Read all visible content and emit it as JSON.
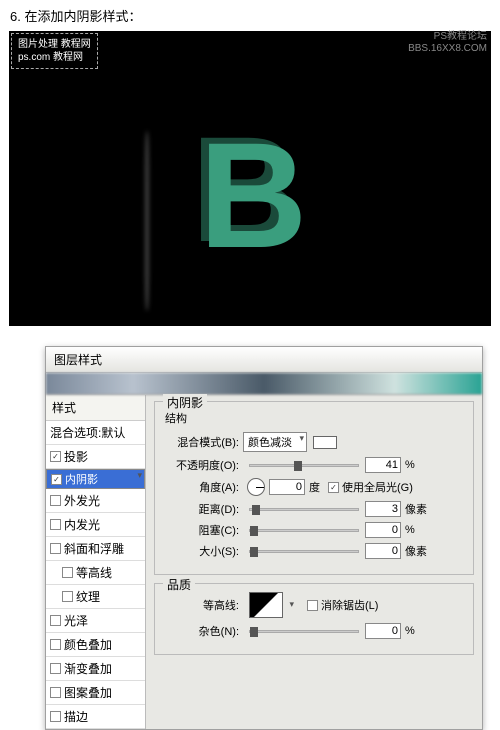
{
  "step_text": "6. 在添加内阴影样式：",
  "watermark_line1": "图片处理 教程网",
  "watermark_line2": "ps.com 教程网",
  "corner_line1": "PS教程论坛",
  "corner_line2": "BBS.16XX8.COM",
  "big_letter": "B",
  "dialog": {
    "title": "图层样式",
    "left_header": "样式",
    "items": [
      {
        "label": "混合选项:默认",
        "checked": null
      },
      {
        "label": "投影",
        "checked": true
      },
      {
        "label": "内阴影",
        "checked": true,
        "selected": true
      },
      {
        "label": "外发光",
        "checked": false
      },
      {
        "label": "内发光",
        "checked": false
      },
      {
        "label": "斜面和浮雕",
        "checked": false
      },
      {
        "label": "等高线",
        "checked": false,
        "sub": true
      },
      {
        "label": "纹理",
        "checked": false,
        "sub": true
      },
      {
        "label": "光泽",
        "checked": false
      },
      {
        "label": "颜色叠加",
        "checked": false
      },
      {
        "label": "渐变叠加",
        "checked": false
      },
      {
        "label": "图案叠加",
        "checked": false
      },
      {
        "label": "描边",
        "checked": false
      }
    ],
    "panel_title": "内阴影",
    "section1": "结构",
    "blend_label": "混合模式(B):",
    "blend_value": "颜色减淡",
    "opacity_label": "不透明度(O):",
    "opacity_value": "41",
    "pct": "%",
    "angle_label": "角度(A):",
    "angle_value": "0",
    "angle_unit": "度",
    "global_label": "使用全局光(G)",
    "distance_label": "距离(D):",
    "distance_value": "3",
    "px": "像素",
    "choke_label": "阻塞(C):",
    "choke_value": "0",
    "size_label": "大小(S):",
    "size_value": "0",
    "section2": "品质",
    "contour_label": "等高线:",
    "aa_label": "消除锯齿(L)",
    "noise_label": "杂色(N):",
    "noise_value": "0"
  }
}
